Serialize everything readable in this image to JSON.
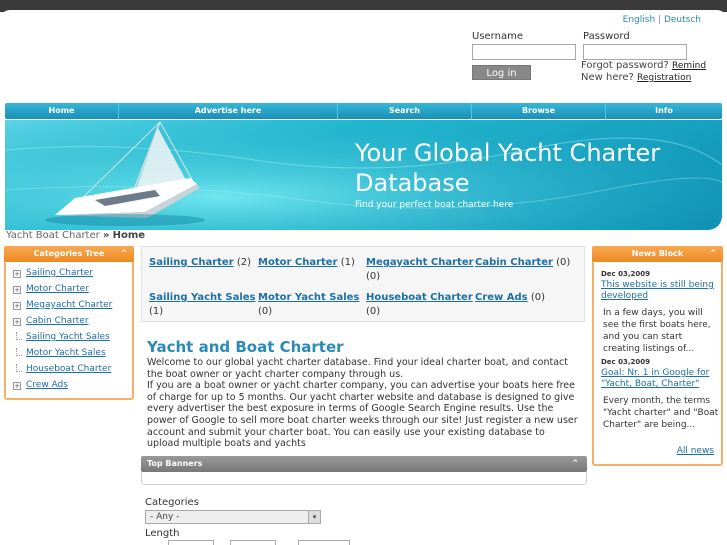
{
  "language": {
    "english": "English",
    "separator": "|",
    "deutsch": "Deutsch"
  },
  "login": {
    "username_label": "Username",
    "password_label": "Password",
    "login_button": "Log in",
    "forgot_text": "Forgot password?",
    "remind_link": "Remind",
    "new_here_text": "New here?",
    "registration_link": "Registration"
  },
  "nav": [
    "Home",
    "Advertise here",
    "Search",
    "Browse",
    "Info"
  ],
  "banner": {
    "title": "Your Global Yacht Charter Database",
    "subtitle": "Find your perfect boat charter here"
  },
  "breadcrumb": {
    "parent": "Yacht Boat Charter",
    "separator": "»",
    "current": "Home"
  },
  "categories_tree": {
    "title": "Categories Tree",
    "items": [
      {
        "label": "Sailing Charter",
        "expandable": true
      },
      {
        "label": "Motor Charter",
        "expandable": true
      },
      {
        "label": "Megayacht Charter",
        "expandable": true
      },
      {
        "label": "Cabin Charter",
        "expandable": true
      },
      {
        "label": "Sailing Yacht Sales",
        "expandable": false
      },
      {
        "label": "Motor Yacht Sales",
        "expandable": false
      },
      {
        "label": "Houseboat Charter",
        "expandable": false
      },
      {
        "label": "Crew Ads",
        "expandable": true
      }
    ]
  },
  "category_grid": [
    {
      "label": "Sailing Charter",
      "count": "(2)"
    },
    {
      "label": "Motor Charter",
      "count": "(1)"
    },
    {
      "label": "Megayacht Charter",
      "count": "(0)"
    },
    {
      "label": "Cabin Charter",
      "count": "(0)"
    },
    {
      "label": "Sailing Yacht Sales",
      "count": "(1)"
    },
    {
      "label": "Motor Yacht Sales",
      "count": "(0)"
    },
    {
      "label": "Houseboat Charter",
      "count": "(0)"
    },
    {
      "label": "Crew Ads",
      "count": "(0)"
    }
  ],
  "main": {
    "heading": "Yacht and Boat Charter",
    "paragraph_1": "Welcome to our global yacht charter database. Find your ideal charter boat, and contact the boat owner or yacht charter company through us.",
    "paragraph_2": "If you are a boat owner or yacht charter company, you can advertise your boats here free of charge for up to 5 months. Our yacht charter website and database is designed to give every advertiser the best exposure in terms of Google Search Engine results. Use the power of Google to sell more boat charter weeks through our site! Just register a new user account and submit your charter boat. You can easily use your existing database to upload multiple boats and yachts"
  },
  "top_banners": {
    "title": "Top Banners"
  },
  "search": {
    "categories_label": "Categories",
    "categories_value": "- Any -",
    "length_label": "Length"
  },
  "news": {
    "title": "News Block",
    "items": [
      {
        "date": "Dec 03,2009",
        "title": "This website is still being developed",
        "text": "In a few days, you will see the first boats here, and you can start creating listings of..."
      },
      {
        "date": "Dec 03,2009",
        "title": "Goal: Nr. 1 in Google for \"Yacht, Boat, Charter\"",
        "text": "Every month, the terms \"Yacht charter\" and \"Boat Charter\" are being..."
      }
    ],
    "all_link": "All news"
  },
  "colors": {
    "accent": "#2a8ab8",
    "nav": "#1a8fb6",
    "box_header": "#ee8a23",
    "link": "#1d6fa8"
  }
}
